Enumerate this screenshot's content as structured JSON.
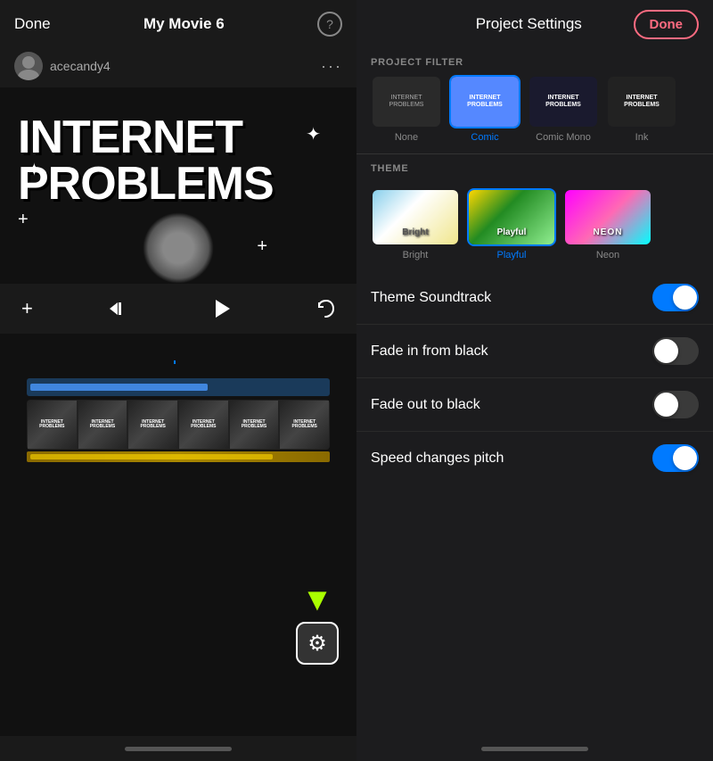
{
  "left": {
    "done_label": "Done",
    "movie_title": "My Movie 6",
    "help_icon": "?",
    "username": "acecandy4",
    "more_icon": "···",
    "video_text_line1": "INTERNET",
    "video_text_line2": "PROBLEMS",
    "transport": {
      "add_icon": "+",
      "rewind_icon": "⏮",
      "play_icon": "▶",
      "undo_icon": "↩"
    },
    "settings_gear_icon": "⚙",
    "home_bar_label": "home-bar"
  },
  "right": {
    "title": "Project Settings",
    "done_label": "Done",
    "section_filter": "PROJECT FILTER",
    "section_theme": "THEME",
    "filters": [
      {
        "id": "none",
        "label": "None",
        "selected": false,
        "text": ""
      },
      {
        "id": "comic",
        "label": "Comic",
        "selected": true,
        "text": "INTERNET\nPROBLEMS"
      },
      {
        "id": "comic-mono",
        "label": "Comic Mono",
        "selected": false,
        "text": "INTERNET\nPROBLEMS"
      },
      {
        "id": "ink",
        "label": "Ink",
        "selected": false,
        "text": "INTERNET\nPROBLEMS"
      }
    ],
    "themes": [
      {
        "id": "bright",
        "label": "Bright",
        "selected": false
      },
      {
        "id": "playful",
        "label": "Playful",
        "selected": true
      },
      {
        "id": "neon",
        "label": "Neon",
        "selected": false
      }
    ],
    "settings": [
      {
        "id": "theme-soundtrack",
        "label": "Theme Soundtrack",
        "on": true
      },
      {
        "id": "fade-in",
        "label": "Fade in from black",
        "on": false
      },
      {
        "id": "fade-out",
        "label": "Fade out to black",
        "on": false
      },
      {
        "id": "speed-pitch",
        "label": "Speed changes pitch",
        "on": true
      }
    ]
  }
}
